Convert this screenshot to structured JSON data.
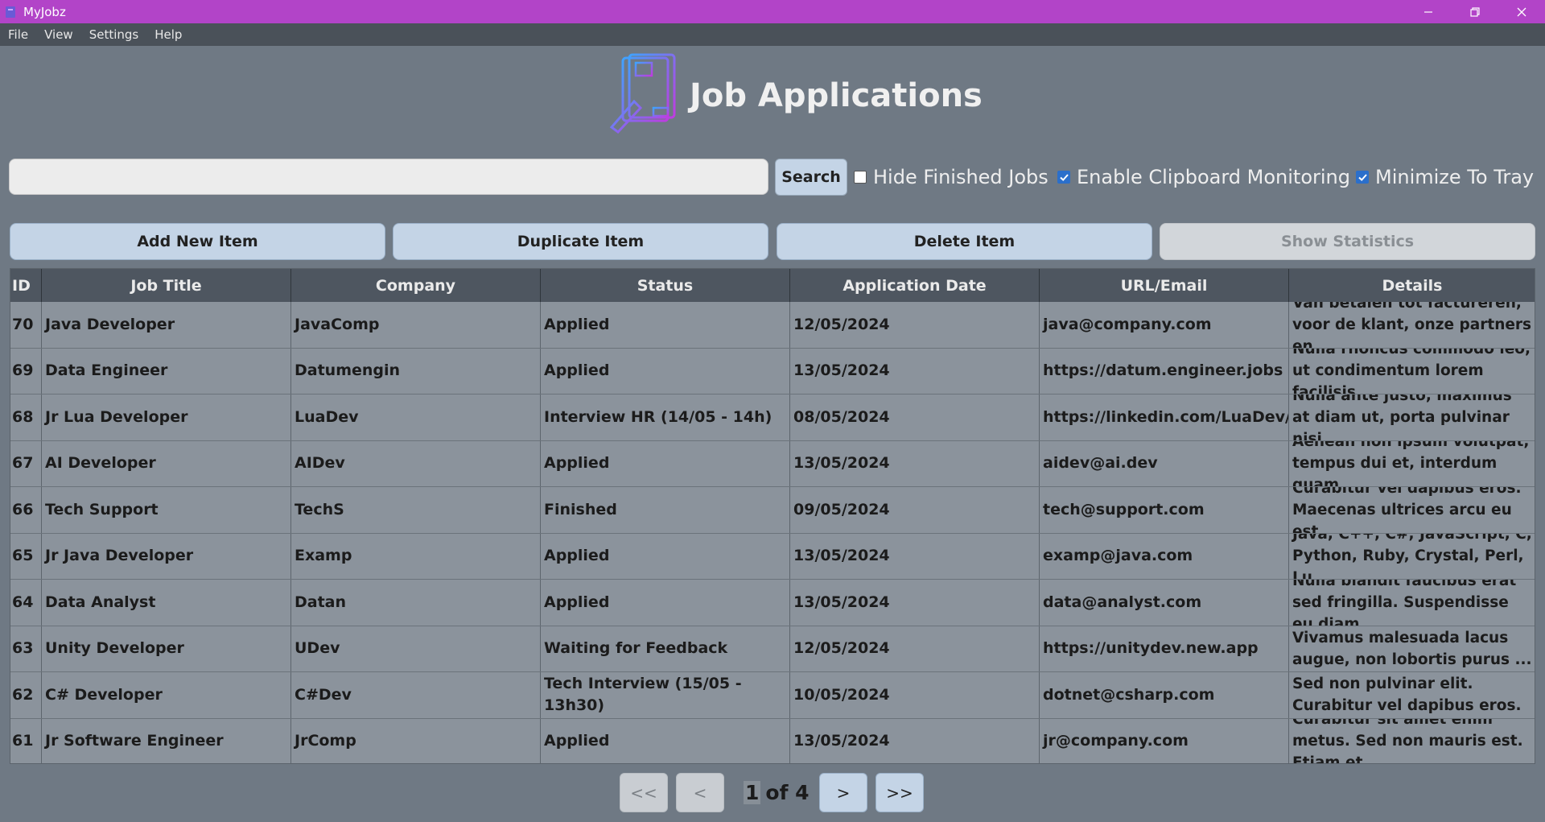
{
  "window": {
    "title": "MyJobz"
  },
  "menu": [
    "File",
    "View",
    "Settings",
    "Help"
  ],
  "header": {
    "title": "Job Applications"
  },
  "search": {
    "value": "",
    "placeholder": "",
    "button_label": "Search"
  },
  "options": {
    "hide_finished": {
      "label": "Hide Finished Jobs",
      "checked": false
    },
    "clipboard": {
      "label": "Enable Clipboard Monitoring",
      "checked": true
    },
    "tray": {
      "label": "Minimize To Tray",
      "checked": true
    }
  },
  "actions": {
    "add": "Add New Item",
    "duplicate": "Duplicate Item",
    "delete": "Delete Item",
    "stats": "Show Statistics"
  },
  "table": {
    "columns": [
      "ID",
      "Job Title",
      "Company",
      "Status",
      "Application Date",
      "URL/Email",
      "Details"
    ],
    "rows": [
      [
        "70",
        "Java Developer",
        "JavaComp",
        "Applied",
        "12/05/2024",
        "java@company.com",
        "Van betalen tot factureren, voor de klant, onze partners en ..."
      ],
      [
        "69",
        "Data Engineer",
        "Datumengin",
        "Applied",
        "13/05/2024",
        "https://datum.engineer.jobs",
        "Nulla rhoncus commodo leo, ut condimentum lorem facilisis ..."
      ],
      [
        "68",
        "Jr Lua Developer",
        "LuaDev",
        "Interview HR (14/05 - 14h)",
        "08/05/2024",
        "https://linkedin.com/LuaDev/apply",
        "Nulla ante justo, maximus at diam ut, porta pulvinar nisi. ..."
      ],
      [
        "67",
        "AI Developer",
        "AIDev",
        "Applied",
        "13/05/2024",
        "aidev@ai.dev",
        "Aenean non ipsum volutpat, tempus dui et, interdum quam...."
      ],
      [
        "66",
        "Tech Support",
        "TechS",
        "Finished",
        "09/05/2024",
        "tech@support.com",
        "Curabitur vel dapibus eros. Maecenas ultrices arcu eu est ..."
      ],
      [
        "65",
        "Jr Java Developer",
        "Examp",
        "Applied",
        "13/05/2024",
        "examp@java.com",
        "Java, C++, C#, JavaScript, C, Python, Ruby, Crystal, Perl, Lu..."
      ],
      [
        "64",
        "Data Analyst",
        "Datan",
        "Applied",
        "13/05/2024",
        "data@analyst.com",
        "Nulla blandit faucibus erat sed fringilla. Suspendisse eu diam ..."
      ],
      [
        "63",
        "Unity Developer",
        "UDev",
        "Waiting for Feedback",
        "12/05/2024",
        "https://unitydev.new.app",
        "Vivamus malesuada lacus augue, non lobortis purus ..."
      ],
      [
        "62",
        "C# Developer",
        "C#Dev",
        "Tech Interview (15/05 - 13h30)",
        "10/05/2024",
        "dotnet@csharp.com",
        "Sed non pulvinar elit. Curabitur vel dapibus eros."
      ],
      [
        "61",
        "Jr Software Engineer",
        "JrComp",
        "Applied",
        "13/05/2024",
        "jr@company.com",
        "Curabitur sit amet enim metus. Sed non mauris est. Etiam et ..."
      ]
    ]
  },
  "pager": {
    "first": "<<",
    "prev": "<",
    "next": ">",
    "last": ">>",
    "current": "1",
    "of_total": "of 4"
  },
  "colors": {
    "titlebar": "#b244c8",
    "accent_button": "#c4d4e6",
    "checkbox": "#2b6fcb"
  }
}
